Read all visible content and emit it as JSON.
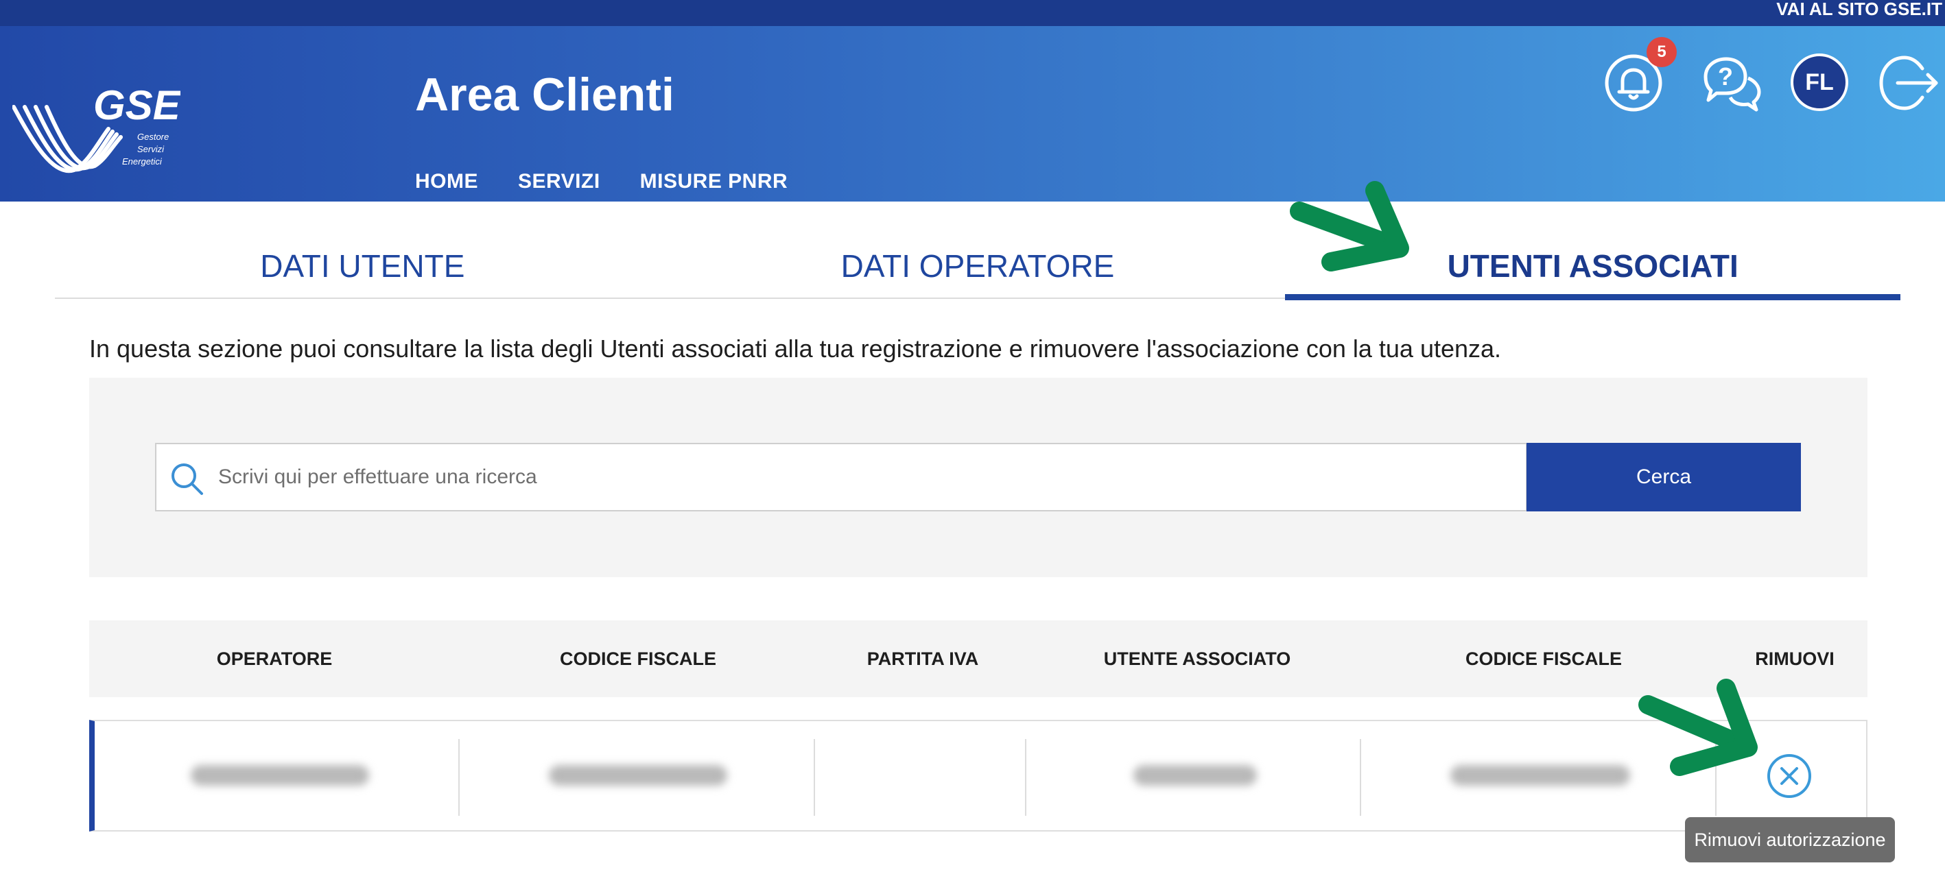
{
  "topbar": {
    "link_label": "VAI AL SITO GSE.IT"
  },
  "header": {
    "logo_name": "GSE",
    "logo_subtitle": [
      "Gestore",
      "Servizi",
      "Energetici"
    ],
    "title": "Area Clienti",
    "nav": [
      "HOME",
      "SERVIZI",
      "MISURE PNRR"
    ],
    "notifications_count": "5",
    "avatar_initials": "FL"
  },
  "tabs": [
    {
      "label": "DATI UTENTE",
      "active": false
    },
    {
      "label": "DATI OPERATORE",
      "active": false
    },
    {
      "label": "UTENTI ASSOCIATI",
      "active": true
    }
  ],
  "description": "In questa sezione puoi consultare la lista degli Utenti associati alla tua registrazione e rimuovere l'associazione con la tua utenza.",
  "search": {
    "placeholder": "Scrivi qui per effettuare una ricerca",
    "value": "",
    "button_label": "Cerca"
  },
  "table": {
    "columns": [
      "OPERATORE",
      "CODICE FISCALE",
      "PARTITA IVA",
      "UTENTE ASSOCIATO",
      "CODICE FISCALE",
      "RIMUOVI"
    ],
    "rows": [
      {
        "operatore": "",
        "codice_fiscale": "",
        "partita_iva": "",
        "utente_associato": "",
        "codice_fiscale_utente": "",
        "blurred": true
      }
    ]
  },
  "tooltip": "Rimuovi autorizzazione",
  "colors": {
    "brand_dark": "#1b3a8c",
    "brand_primary": "#2044a2",
    "accent_light_blue": "#4aa8e6",
    "annotation_green": "#0a8a4f",
    "badge_red": "#e0463f"
  }
}
